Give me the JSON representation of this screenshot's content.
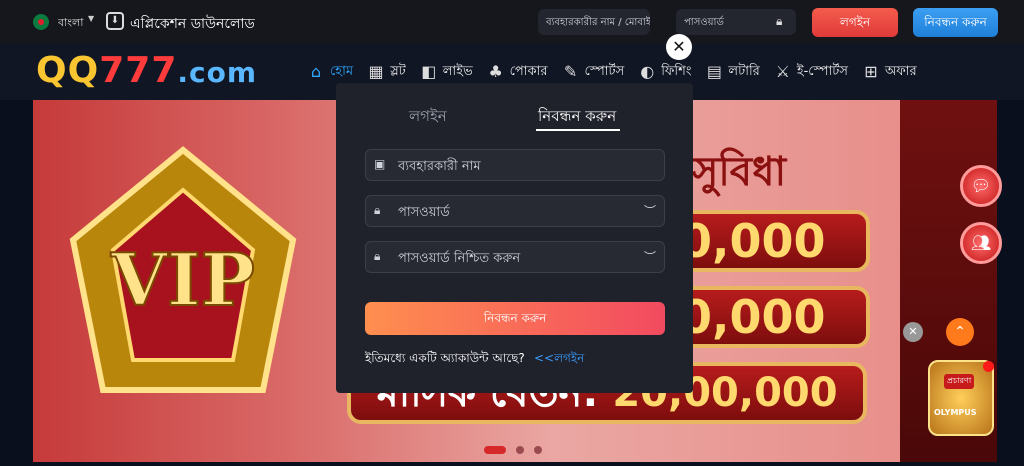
{
  "topbar": {
    "language": "বাংলা",
    "app_download": "এপ্লিকেশন ডাউনলোড",
    "username_placeholder": "ব্যবহারকারীর নাম / মোবাইল",
    "password_placeholder": "পাসওয়ার্ড",
    "login_button": "লগইন",
    "register_button": "নিবন্ধন করুন"
  },
  "logo": {
    "part1": "QQ",
    "part2": "777",
    "part3": ".com"
  },
  "nav": [
    {
      "icon": "home-icon",
      "label": "হোম",
      "active": true
    },
    {
      "icon": "slot-icon",
      "label": "স্লট"
    },
    {
      "icon": "live-icon",
      "label": "লাইভ"
    },
    {
      "icon": "poker-icon",
      "label": "পোকার"
    },
    {
      "icon": "sports-icon",
      "label": "স্পোর্টস"
    },
    {
      "icon": "fishing-icon",
      "label": "ফিশিং"
    },
    {
      "icon": "lottery-icon",
      "label": "লটারি"
    },
    {
      "icon": "esports-icon",
      "label": "ই-স্পোর্টস"
    },
    {
      "icon": "offer-icon",
      "label": "অফার"
    }
  ],
  "banner": {
    "headline": "দ সুবিধা",
    "amount1": "00,000",
    "amount2": "00,000",
    "salary_label": "মাসিক বেতন:",
    "salary_amount": "20,00,000",
    "vip_text": "VIP"
  },
  "modal": {
    "tab_login": "লগইন",
    "tab_register": "নিবন্ধন করুন",
    "username_placeholder": "ব্যবহারকারী নাম",
    "password_placeholder": "পাসওয়ার্ড",
    "confirm_placeholder": "পাসওয়ার্ড নিশ্চিত করুন",
    "submit": "নিবন্ধন করুন",
    "have_account": "ইতিমধ্যে একটি অ্যাকাউন্ট আছে?",
    "login_link": "<<লগইন"
  },
  "promo": {
    "tag": "প্রচারণা",
    "title": "OLYMPUS"
  },
  "colors": {
    "accent_blue": "#2fa8ff",
    "login_red": "#e03a3a",
    "register_blue": "#1f7fd8",
    "submit_gradient_start": "#ff8f4f",
    "submit_gradient_end": "#f24a60"
  }
}
